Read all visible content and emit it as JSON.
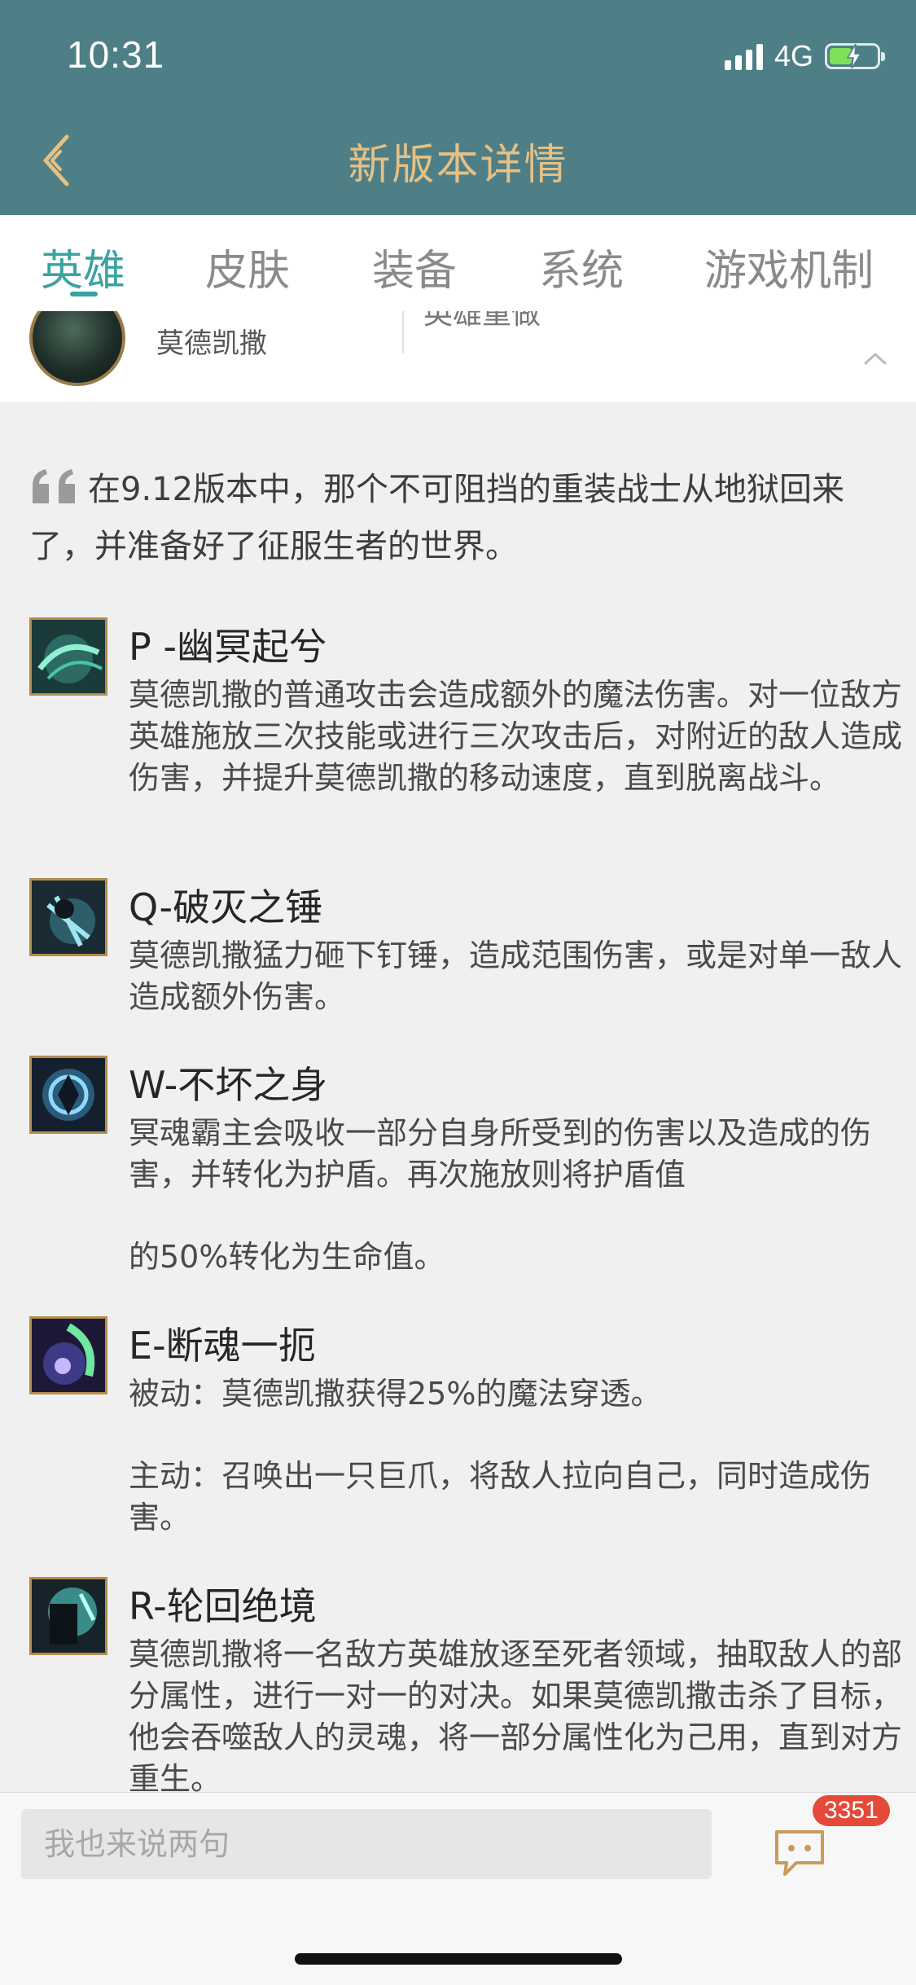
{
  "status_bar": {
    "time": "10:31",
    "network": "4G"
  },
  "header": {
    "title": "新版本详情"
  },
  "tabs": [
    {
      "label": "英雄",
      "active": true
    },
    {
      "label": "皮肤",
      "active": false
    },
    {
      "label": "装备",
      "active": false
    },
    {
      "label": "系统",
      "active": false
    },
    {
      "label": "游戏机制",
      "active": false
    }
  ],
  "hero": {
    "name": "莫德凯撒",
    "subtitle": "英雄重做"
  },
  "quote": "在9.12版本中，那个不可阻挡的重装战士从地狱回来了，并准备好了征服生者的世界。",
  "skills": [
    {
      "title": "P -幽冥起兮",
      "icon": "passive-skill-icon",
      "paragraphs": [
        "莫德凯撒的普通攻击会造成额外的魔法伤害。对一位敌方英雄施放三次技能或进行三次攻击后，对附近的敌人造成伤害，并提升莫德凯撒的移动速度，直到脱离战斗。"
      ]
    },
    {
      "title": "Q-破灭之锤",
      "icon": "q-skill-icon",
      "paragraphs": [
        "莫德凯撒猛力砸下钉锤，造成范围伤害，或是对单一敌人造成额外伤害。"
      ]
    },
    {
      "title": "W-不坏之身",
      "icon": "w-skill-icon",
      "paragraphs": [
        "冥魂霸主会吸收一部分自身所受到的伤害以及造成的伤害，并转化为护盾。再次施放则将护盾值",
        "的50%转化为生命值。"
      ]
    },
    {
      "title": "E-断魂一扼",
      "icon": "e-skill-icon",
      "paragraphs": [
        "被动：莫德凯撒获得25%的魔法穿透。",
        "主动：召唤出一只巨爪，将敌人拉向自己，同时造成伤害。"
      ]
    },
    {
      "title": "R-轮回绝境",
      "icon": "r-skill-icon",
      "paragraphs": [
        "莫德凯撒将一名敌方英雄放逐至死者领域，抽取敌人的部分属性，进行一对一的对决。如果莫德凯撒击杀了目标，他会吞噬敌人的灵魂，将一部分属性化为己用，直到对方重生。"
      ]
    }
  ],
  "comment_bar": {
    "placeholder": "我也来说两句",
    "comment_count": "3351"
  },
  "colors": {
    "header_bg": "#4e7f86",
    "title_gold": "#e6c084",
    "accent_teal": "#3aa3a2",
    "badge_red": "#e5493a"
  }
}
